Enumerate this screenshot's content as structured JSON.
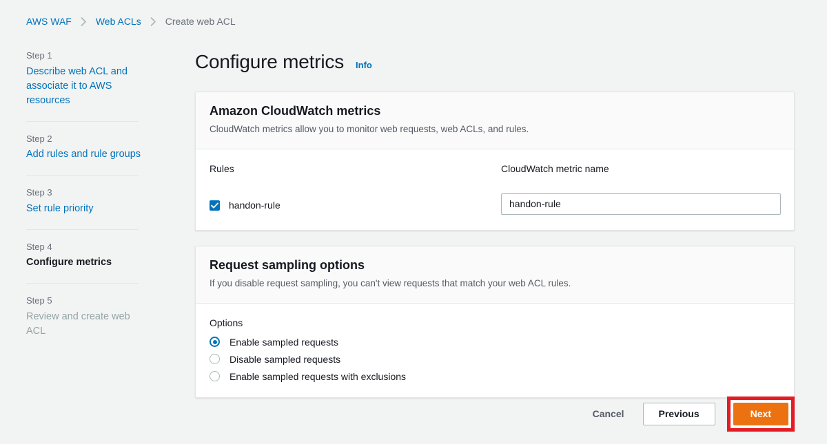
{
  "breadcrumb": {
    "items": [
      {
        "label": "AWS WAF",
        "type": "link"
      },
      {
        "label": "Web ACLs",
        "type": "link"
      },
      {
        "label": "Create web ACL",
        "type": "current"
      }
    ],
    "separator_icon": "chevron-right-icon"
  },
  "sidebar": {
    "steps": [
      {
        "num": "Step 1",
        "title": "Describe web ACL and associate it to AWS resources",
        "state": "link"
      },
      {
        "num": "Step 2",
        "title": "Add rules and rule groups",
        "state": "link"
      },
      {
        "num": "Step 3",
        "title": "Set rule priority",
        "state": "link"
      },
      {
        "num": "Step 4",
        "title": "Configure metrics",
        "state": "active"
      },
      {
        "num": "Step 5",
        "title": "Review and create web ACL",
        "state": "disabled"
      }
    ]
  },
  "page": {
    "title": "Configure metrics",
    "info_label": "Info"
  },
  "cloudwatch_card": {
    "title": "Amazon CloudWatch metrics",
    "description": "CloudWatch metrics allow you to monitor web requests, web ACLs, and rules.",
    "columns": {
      "rules": "Rules",
      "metric_name": "CloudWatch metric name"
    },
    "rows": [
      {
        "rule_label": "handon-rule",
        "checked": true,
        "metric_value": "handon-rule",
        "metric_placeholder": "Enter metric name"
      }
    ]
  },
  "sampling_card": {
    "title": "Request sampling options",
    "description": "If you disable request sampling, you can't view requests that match your web ACL rules.",
    "options_label": "Options",
    "options": [
      {
        "label": "Enable sampled requests",
        "selected": true
      },
      {
        "label": "Disable sampled requests",
        "selected": false
      },
      {
        "label": "Enable sampled requests with exclusions",
        "selected": false
      }
    ]
  },
  "footer": {
    "cancel_label": "Cancel",
    "previous_label": "Previous",
    "next_label": "Next"
  },
  "colors": {
    "link": "#0073bb",
    "accent_orange": "#ec7211",
    "highlight_red": "#e31b23",
    "page_background": "#f2f3f3",
    "card_header": "#fafafa",
    "border": "#e3e5e6"
  }
}
